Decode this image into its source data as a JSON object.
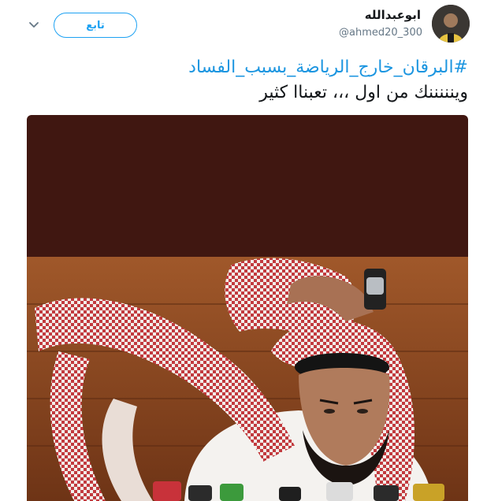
{
  "author": {
    "name": "ابوعبدالله",
    "handle": "@ahmed20_300"
  },
  "follow_label": "تابع",
  "tweet": {
    "hashtag": "#البرقان_خارج_الرياضة_بسبب_الفساد",
    "body": "وينننننك من اول ،،، تعبناا كثير"
  },
  "colors": {
    "accent": "#1da1f2",
    "hashtag": "#1b95e0",
    "photo_top": "#401711",
    "photo_wall": "#8a4320"
  },
  "icons": [
    "chevron-down-icon"
  ]
}
